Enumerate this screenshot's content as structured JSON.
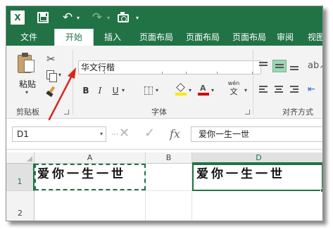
{
  "app": {
    "logo_letter": "X"
  },
  "colors": {
    "accent": "#217346",
    "arrow": "#d9261c",
    "fill_yellow": "#ffe800",
    "font_red": "#d00000"
  },
  "tabs": [
    {
      "label": "文件"
    },
    {
      "label": "开始"
    },
    {
      "label": "插入"
    },
    {
      "label": "页面布局"
    },
    {
      "label": "页面布局"
    },
    {
      "label": "页面布局"
    },
    {
      "label": "审阅"
    },
    {
      "label": "视图"
    }
  ],
  "ribbon": {
    "clipboard": {
      "paste_label": "粘贴",
      "group_label": "剪贴板"
    },
    "font": {
      "font_name": "华文行楷",
      "bold": "B",
      "italic": "I",
      "underline": "U",
      "font_color_letter": "A",
      "phonetic_top": "wén",
      "phonetic_bottom": "文",
      "group_label": "字体"
    },
    "alignment": {
      "group_label": "对齐方式"
    }
  },
  "formula_bar": {
    "name_box": "D1",
    "fx": "fx",
    "content": "爱你一生一世"
  },
  "sheet": {
    "columns": [
      "A",
      "B",
      "D"
    ],
    "rows": [
      "1",
      "2"
    ],
    "cells": {
      "A1": "爱你一生一世",
      "D1": "爱你一生一世"
    }
  },
  "icons": [
    "excel-logo-icon",
    "save-icon",
    "undo-icon",
    "redo-icon",
    "camera-icon",
    "cut-icon",
    "copy-icon",
    "format-painter-icon",
    "border-icon",
    "fill-color-icon",
    "font-color-icon",
    "phonetic-icon",
    "cancel-icon",
    "enter-icon",
    "annotation-arrow"
  ]
}
